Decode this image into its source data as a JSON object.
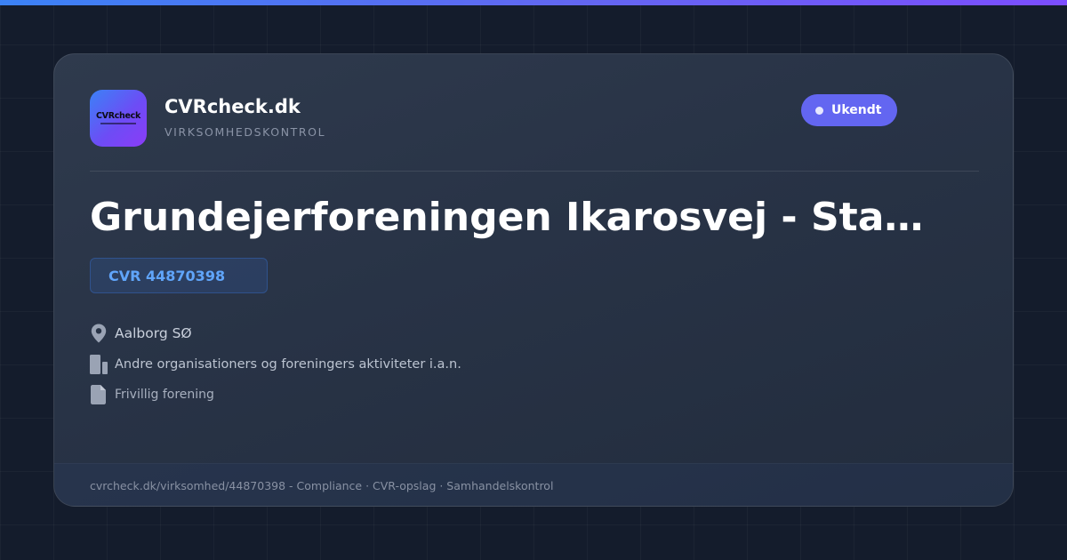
{
  "brand": {
    "logo_text": "CVRcheck",
    "name": "CVRcheck.dk",
    "tagline": "VIRKSOMHEDSKONTROL"
  },
  "status": {
    "label": "Ukendt",
    "color": "#6366f1"
  },
  "company": {
    "name": "Grundejerforeningen Ikarosvej - Stamvej",
    "cvr_label": "CVR 44870398",
    "location": "Aalborg SØ",
    "industry": "Andre organisationers og foreningers aktiviteter i.a.n.",
    "legal_form": "Frivillig forening"
  },
  "icons": {
    "location": "map-pin-icon",
    "industry": "building-icon",
    "legal_form": "document-icon"
  },
  "footer": {
    "text": "cvrcheck.dk/virksomhed/44870398 - Compliance · CVR-opslag · Samhandelskontrol"
  },
  "colors": {
    "accent": "#6366f1",
    "cvr": "#60a5fa",
    "background": "#141c2c"
  }
}
